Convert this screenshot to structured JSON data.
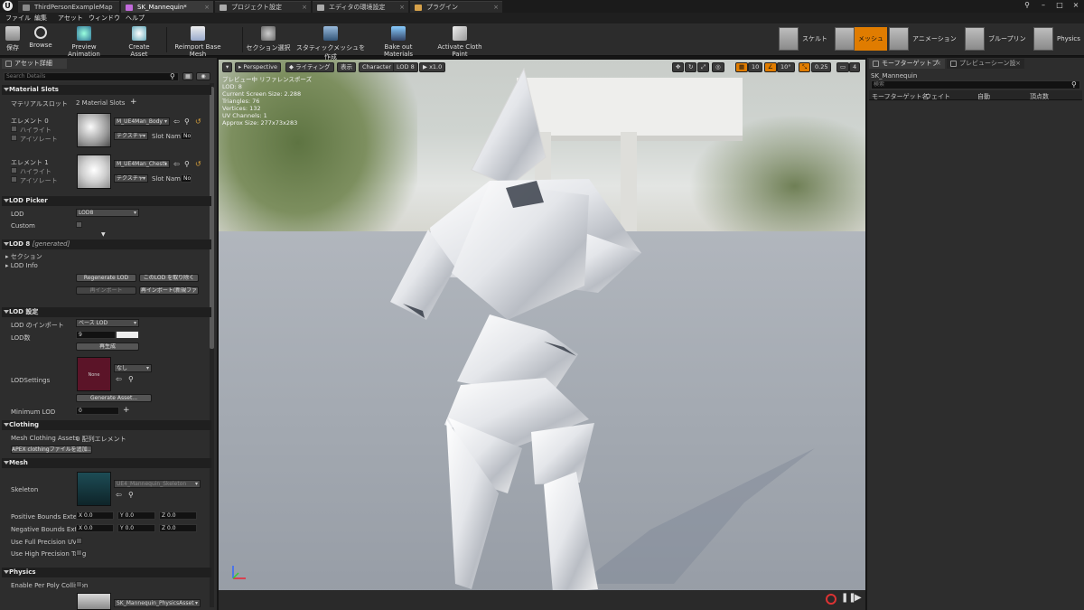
{
  "window": {
    "tabs": [
      {
        "label": "ThirdPersonExampleMap"
      },
      {
        "label": "SK_Mannequin*"
      },
      {
        "label": "プロジェクト設定"
      },
      {
        "label": "エディタの環境設定"
      },
      {
        "label": "プラグイン"
      }
    ]
  },
  "menu": [
    "ファイル",
    "編集",
    "アセット",
    "ウィンドウ",
    "ヘルプ"
  ],
  "toolbar": {
    "items": [
      "保存",
      "Browse",
      "Preview Animation",
      "Create Asset",
      "Reimport Base Mesh",
      "セクション選択",
      "スタティックメッシュを作成",
      "Bake out Materials",
      "Activate Cloth Paint"
    ],
    "modes": [
      "スケルトン",
      "メッシュ",
      "アニメーション",
      "ブループリント",
      "Physics"
    ]
  },
  "details": {
    "tab_label": "アセット詳細",
    "search_placeholder": "Search Details",
    "sections": {
      "material_slots": "Material Slots",
      "lod_picker": "LOD Picker",
      "lod8": "LOD 8",
      "lod8_suffix": "[generated]",
      "lod_settings": "LOD 設定",
      "clothing": "Clothing",
      "mesh": "Mesh",
      "physics": "Physics"
    },
    "material_slots_label": "マテリアルスロット",
    "material_slots_count": "2 Material Slots",
    "elements": [
      {
        "label": "エレメント 0",
        "highlight": "ハイライト",
        "isolate": "アイソレート",
        "material": "M_UE4Man_Body",
        "texture": "テクスチャ",
        "slot_name_label": "Slot Name",
        "slot_name_value": "No"
      },
      {
        "label": "エレメント 1",
        "highlight": "ハイライト",
        "isolate": "アイソレート",
        "material": "M_UE4Man_ChestL",
        "texture": "テクスチャ",
        "slot_name_label": "Slot Name",
        "slot_name_value": "No"
      }
    ],
    "lod_label": "LOD",
    "lod_value": "LOD8",
    "custom_label": "Custom",
    "section_label": "セクション",
    "lod_info_label": "LOD Info",
    "regenerate_lod": "Regenerate LOD",
    "remove_lod": "このLOD を取り除く",
    "reimport": "再インポート",
    "reimport_new": "再インポート(新規ファ",
    "lod_import_label": "LOD のインポート",
    "lod_import_value": "ベース LOD",
    "lod_count_label": "LOD数",
    "lod_count_value": "9",
    "regenerate": "再生成",
    "lod_settings_label": "LODSettings",
    "lod_settings_asset": "None",
    "lod_settings_value": "なし",
    "generate_asset": "Generate Asset...",
    "min_lod_label": "Minimum LOD",
    "min_lod_value": "0",
    "mesh_clothing_label": "Mesh Clothing Assets",
    "mesh_clothing_value": "0 配列エレメント",
    "add_apex": "APEX clothingファイルを追加...",
    "skeleton_label": "Skeleton",
    "skeleton_value": "UE4_Mannequin_Skeleton",
    "pos_bounds_label": "Positive Bounds Extensi",
    "neg_bounds_label": "Negative Bounds Extensi",
    "pos_bounds": {
      "x": "X 0.0",
      "y": "Y 0.0",
      "z": "Z 0.0"
    },
    "neg_bounds": {
      "x": "X 0.0",
      "y": "Y 0.0",
      "z": "Z 0.0"
    },
    "full_precision_uvs": "Use Full Precision UVs",
    "high_precision_tang": "Use High Precision Tang",
    "per_poly_collision": "Enable Per Poly Collision",
    "physics_asset": "SK_Mannequin_PhysicsAsset"
  },
  "viewport": {
    "buttons": {
      "perspective": "Perspective",
      "lighting": "ライティング",
      "show": "表示",
      "character": "Character",
      "lod": "LOD 8",
      "speed": "x1.0"
    },
    "right_controls": {
      "grid": "10",
      "angle": "10°",
      "scale": "0.25",
      "cam": "4"
    },
    "info": [
      "プレビュー中 リファレンスポーズ",
      "LOD: 8",
      "Current Screen Size: 2.288",
      "Triangles: 76",
      "Vertices: 132",
      "UV Channels: 1",
      "Approx Size: 277x73x283"
    ]
  },
  "morph": {
    "tabs": [
      "モーフターゲットプ",
      "プレビューシーン設"
    ],
    "asset_name": "SK_Mannequin",
    "search_placeholder": "検索",
    "columns": [
      "モーフターゲット名",
      "ウェイト",
      "自動",
      "頂点数"
    ]
  },
  "colors": {
    "accent": "#e07c00",
    "panel": "#2d2d2d",
    "header": "#1f1f1f"
  }
}
